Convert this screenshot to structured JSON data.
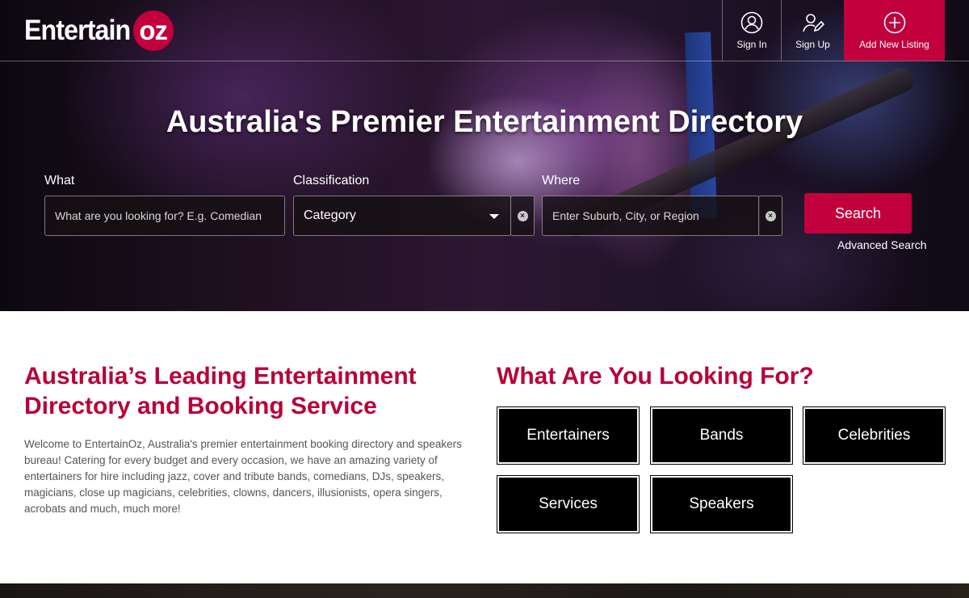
{
  "brand": {
    "logo_main": "Entertain",
    "logo_badge": "oz",
    "accent_color": "#c2003d"
  },
  "nav": {
    "sign_in": "Sign In",
    "sign_up": "Sign Up",
    "add_listing": "Add New Listing"
  },
  "hero": {
    "title": "Australia's Premier Entertainment Directory",
    "search": {
      "what_label": "What",
      "what_placeholder": "What are you looking for? E.g. Comedian",
      "classification_label": "Classification",
      "classification_value": "Category",
      "where_label": "Where",
      "where_placeholder": "Enter Suburb, City, or Region",
      "search_button": "Search",
      "advanced_link": "Advanced Search"
    }
  },
  "intro": {
    "title": "Australia’s Leading Entertainment Directory and Booking Service",
    "body": "Welcome to EntertainOz, Australia's premier entertainment booking directory and speakers bureau! Catering for every budget and every occasion, we have an amazing variety of entertainers for hire including jazz, cover and tribute bands, comedians, DJs, speakers, magicians, close up magicians, celebrities, clowns, dancers, illusionists, opera singers, acrobats and much, much more!"
  },
  "categories": {
    "title": "What Are You Looking For?",
    "items": [
      "Entertainers",
      "Bands",
      "Celebrities",
      "Services",
      "Speakers"
    ]
  }
}
